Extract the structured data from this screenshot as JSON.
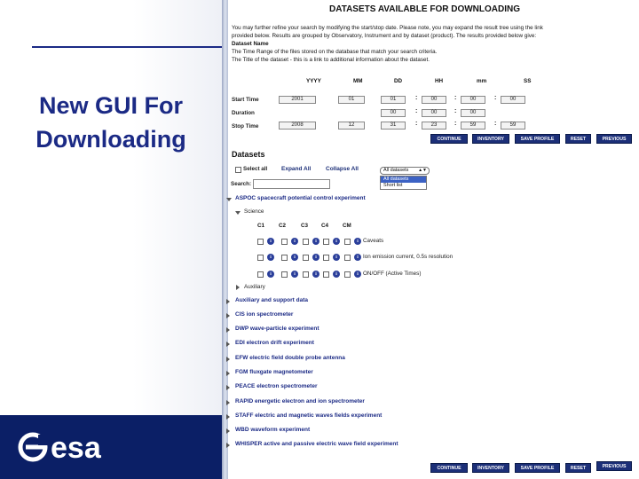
{
  "slide": {
    "title_line1": "New GUI For",
    "title_line2": "Downloading",
    "logo_text": "esa"
  },
  "app": {
    "heading": "DATASETS AVAILABLE FOR DOWNLOADING",
    "intro_1": "You may further refine your search by modifying the start/stop date. Please note, you may expand the result tree using the link",
    "intro_2": "provided below. Results are grouped by Observatory, Instrument and by dataset (product). The results provided below give:",
    "intro_3": "Dataset Name",
    "intro_4": "The Time Range of the files stored on the database that match your search criteria.",
    "intro_5": "The Title of the dataset - this is a link to additional information about the dataset.",
    "columns": [
      "YYYY",
      "MM",
      "DD",
      "HH",
      "mm",
      "SS"
    ],
    "time_rows": [
      {
        "label": "Start Time",
        "values": [
          "2001",
          "01",
          "01",
          "00",
          "00",
          "00"
        ]
      },
      {
        "label": "Duration",
        "values": [
          "",
          "",
          "00",
          "00",
          "00",
          ""
        ]
      },
      {
        "label": "Stop Time",
        "values": [
          "2008",
          "12",
          "31",
          "23",
          "59",
          "59"
        ]
      }
    ],
    "buttons": {
      "continue": "CONTINUE",
      "inventory": "INVENTORY",
      "save_profile": "SAVE PROFILE",
      "reset": "RESET",
      "previous": "PREVIOUS"
    },
    "datasets_heading": "Datasets",
    "select_all": "Select all",
    "expand_all": "Expand All",
    "collapse_all": "Collapse All",
    "filter_selected": "All datasets",
    "filter_options": [
      "All datasets",
      "Short list"
    ],
    "search_label": "Search:",
    "search_value": "",
    "aspoc": "ASPOC spacecraft potential control experiment",
    "science": "Science",
    "spacecraft": [
      "C1",
      "C2",
      "C3",
      "C4",
      "CM"
    ],
    "science_rows": [
      "Caveats",
      "Ion emission current, 0.5s resolution",
      "ON/OFF (Active Times)"
    ],
    "auxiliary": "Auxiliary",
    "instruments": [
      "Auxiliary and support data",
      "CIS ion spectrometer",
      "DWP wave-particle experiment",
      "EDI electron drift experiment",
      "EFW electric field double probe antenna",
      "FGM fluxgate magnetometer",
      "PEACE electron spectrometer",
      "RAPID energetic electron and ion spectrometer",
      "STAFF electric and magnetic waves fields experiment",
      "WBD waveform experiment",
      "WHISPER active and passive electric wave field experiment"
    ],
    "colors": {
      "navy": "#1b2a85",
      "button": "#1c2f78",
      "footer": "#0b1f66"
    }
  }
}
